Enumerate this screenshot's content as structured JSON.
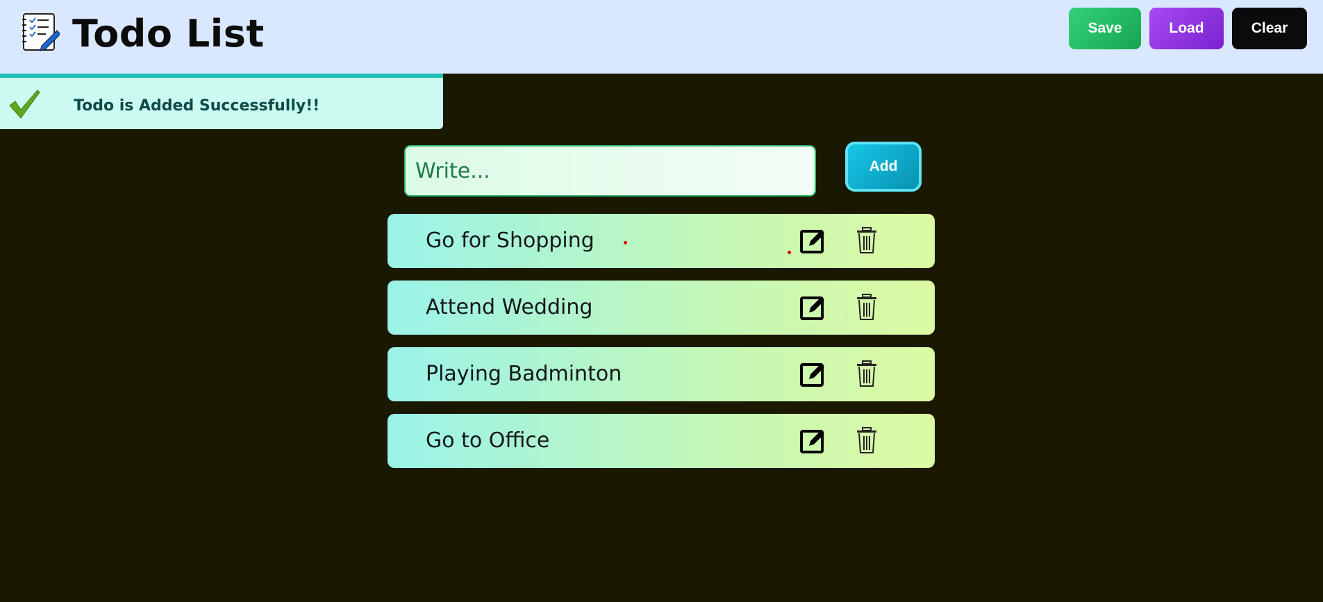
{
  "header": {
    "title": "Todo List",
    "buttons": {
      "save": "Save",
      "load": "Load",
      "clear": "Clear"
    }
  },
  "toast": {
    "message": "Todo is Added Successfully!!"
  },
  "input": {
    "placeholder": "Write...",
    "value": ""
  },
  "add_button": "Add",
  "todos": [
    {
      "text": "Go for Shopping"
    },
    {
      "text": "Attend Wedding"
    },
    {
      "text": "Playing Badminton"
    },
    {
      "text": "Go to Office"
    }
  ],
  "colors": {
    "header_bg": "#dae8ff",
    "page_bg": "#1a1800",
    "save": "#22c55e",
    "load": "#9333ea",
    "clear": "#0b0b0d",
    "toast_bg": "#cbfbf0",
    "add": "#06b6d4"
  },
  "icons": {
    "logo": "checklist-notepad-icon",
    "toast": "checkmark-icon",
    "edit": "edit-icon",
    "delete": "trash-icon"
  }
}
